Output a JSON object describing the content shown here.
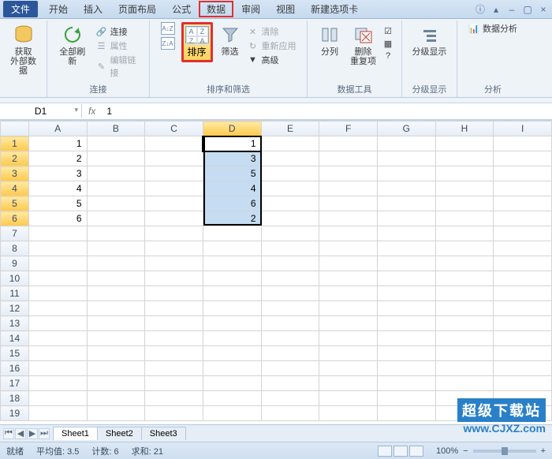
{
  "menu": {
    "file": "文件",
    "items": [
      "开始",
      "插入",
      "页面布局",
      "公式",
      "数据",
      "审阅",
      "视图",
      "新建选项卡"
    ],
    "highlighted_index": 4
  },
  "ribbon": {
    "groups": {
      "external": {
        "label": "获取\n外部数据"
      },
      "connections": {
        "label": "连接",
        "refresh": "全部刷新",
        "items": [
          "连接",
          "属性",
          "编辑链接"
        ]
      },
      "sort_filter": {
        "label": "排序和筛选",
        "sort": "排序",
        "filter": "筛选",
        "filter_items": [
          "清除",
          "重新应用",
          "高级"
        ]
      },
      "data_tools": {
        "label": "数据工具",
        "split": "分列",
        "dedup": "删除\n重复项"
      },
      "outline": {
        "label": "分级显示",
        "btn": "分级显示"
      },
      "analysis": {
        "label": "分析",
        "btn": "数据分析"
      }
    }
  },
  "formula_bar": {
    "name": "D1",
    "fx": "fx",
    "value": "1"
  },
  "grid": {
    "columns": [
      "A",
      "B",
      "C",
      "D",
      "E",
      "F",
      "G",
      "H",
      "I"
    ],
    "rows": 19,
    "selected_col": 3,
    "selected_rows": [
      0,
      1,
      2,
      3,
      4,
      5
    ],
    "data": {
      "A": [
        1,
        2,
        3,
        4,
        5,
        6
      ],
      "D": [
        1,
        3,
        5,
        4,
        6,
        2
      ]
    }
  },
  "sheets": {
    "tabs": [
      "Sheet1",
      "Sheet2",
      "Sheet3"
    ],
    "active": 0
  },
  "status": {
    "ready": "就绪",
    "avg_label": "平均值:",
    "avg": "3.5",
    "count_label": "计数:",
    "count": "6",
    "sum_label": "求和:",
    "sum": "21",
    "zoom": "100%"
  },
  "watermark": {
    "line1": "超级下载站",
    "line2": "www.CJXZ.com"
  }
}
